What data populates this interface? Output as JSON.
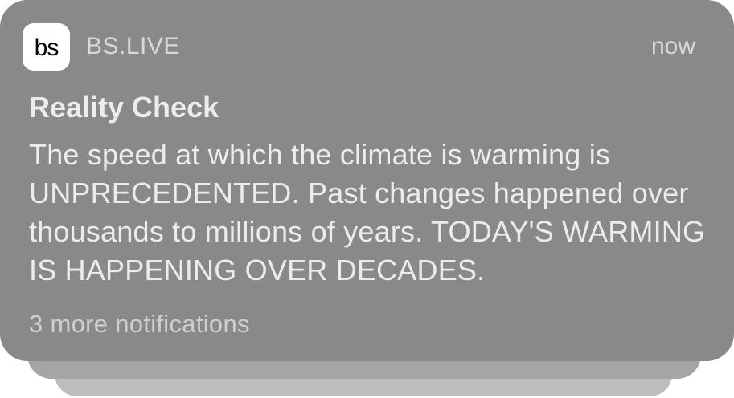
{
  "notification": {
    "app_icon_text": "bs",
    "app_name": "BS.LIVE",
    "timestamp": "now",
    "title": "Reality Check",
    "body": "The speed at which the climate is warming is UNPRECEDENTED. Past changes happened over thousands to millions of years. TODAY'S WARMING IS HAPPENING OVER DECADES.",
    "more_label": "3 more notifications"
  },
  "colors": {
    "card_background": "#898989",
    "stack_layer_1": "#a5a5a5",
    "stack_layer_2": "#bdbdbd",
    "icon_background": "#ffffff"
  }
}
